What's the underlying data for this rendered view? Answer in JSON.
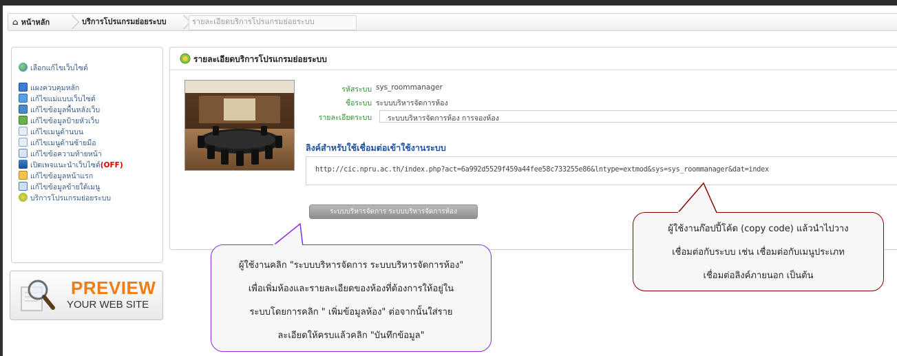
{
  "breadcrumb": {
    "home": "หน้าหลัก",
    "level2": "บริการโปรแกรมย่อยระบบ",
    "level3": "รายละเอียดบริการโปรแกรมย่อยระบบ"
  },
  "sidebar": {
    "top_item": "เลือกแก้ไขเว็บไซต์",
    "items": [
      {
        "label": "แผงควบคุมหลัก",
        "icon": "grid-icon"
      },
      {
        "label": "แก้ไขแม่แบบเว็บไซต์",
        "icon": "template-icon"
      },
      {
        "label": "แก้ไขข้อมูลพื้นหลังเว็บ",
        "icon": "background-icon"
      },
      {
        "label": "แก้ไขข้อมูลป้ายหัวเว็บ",
        "icon": "banner-icon"
      },
      {
        "label": "แก้ไขเมนูด้านบน",
        "icon": "top-menu-icon"
      },
      {
        "label": "แก้ไขเมนูด้านซ้ายมือ",
        "icon": "left-menu-icon"
      },
      {
        "label": "แก้ไขข้อความท้ายหน้า",
        "icon": "footer-icon"
      },
      {
        "label": "เปิดเพจแนะนำเว็บไซต์",
        "icon": "intro-page-icon",
        "badge": "(OFF)"
      },
      {
        "label": "แก้ไขข้อมูลหน้าแรก",
        "icon": "home-icon"
      },
      {
        "label": "แก้ไขข้อมูลข้ายใต้เมนู",
        "icon": "under-menu-icon"
      },
      {
        "label": "บริการโปรแกรมย่อยระบบ",
        "icon": "module-icon"
      }
    ],
    "preview": {
      "title": "PREVIEW",
      "subtitle": "YOUR WEB SITE"
    }
  },
  "panel": {
    "title": "รายละเอียดบริการโปรแกรมย่อยระบบ",
    "fields": {
      "code_label": "รหัสระบบ",
      "code_value": "sys_roommanager",
      "name_label": "ชื่อระบบ",
      "name_value": "ระบบบริหารจัดการห้อง",
      "detail_label": "รายละเอียดระบบ",
      "detail_value": "ระบบบริหารจัดการห้อง การจองห้อง"
    },
    "link_title": "ลิงค์สำหรับใช้เชื่อมต่อเข้าใช้งานระบบ",
    "link_url": "http://cic.npru.ac.th/index.php?act=6a992d5529f459a44fee58c733255e86&lntype=extmod&sys=sys_roommanager&dat=index",
    "button_label": "ระบบบริหารจัดการ ระบบบริหารจัดการห้อง"
  },
  "callouts": {
    "purple_lines": [
      "ผู้ใช้งานคลิก \"ระบบบริหารจัดการ ระบบบริหารจัดการห้อง\"",
      "เพื่อเพิ่มห้องและรายละเอียดของห้องที่ต้องการให้อยู่ใน",
      "ระบบโดยการคลิก \" เพิ่มข้อมูลห้อง\" ต่อจากนั้นใส่ราย",
      "ละเอียดให้ครบแล้วคลิก \"บันทึกข้อมูล\""
    ],
    "red_lines": [
      "ผู้ใช้งานก๊อปปี้โค้ด (copy code) แล้วนำไปวาง",
      "เชื่อมต่อกับระบบ เช่น เชื่อมต่อกับเมนูประเภท",
      "เชื่อมต่อลิงค์ภายนอก เป็นต้น"
    ]
  },
  "colors": {
    "link_blue": "#1f52a3",
    "label_green": "#2f8f2f",
    "preview_orange": "#f07c12",
    "callout_purple": "#8a2be2",
    "callout_red": "#8b0000"
  }
}
